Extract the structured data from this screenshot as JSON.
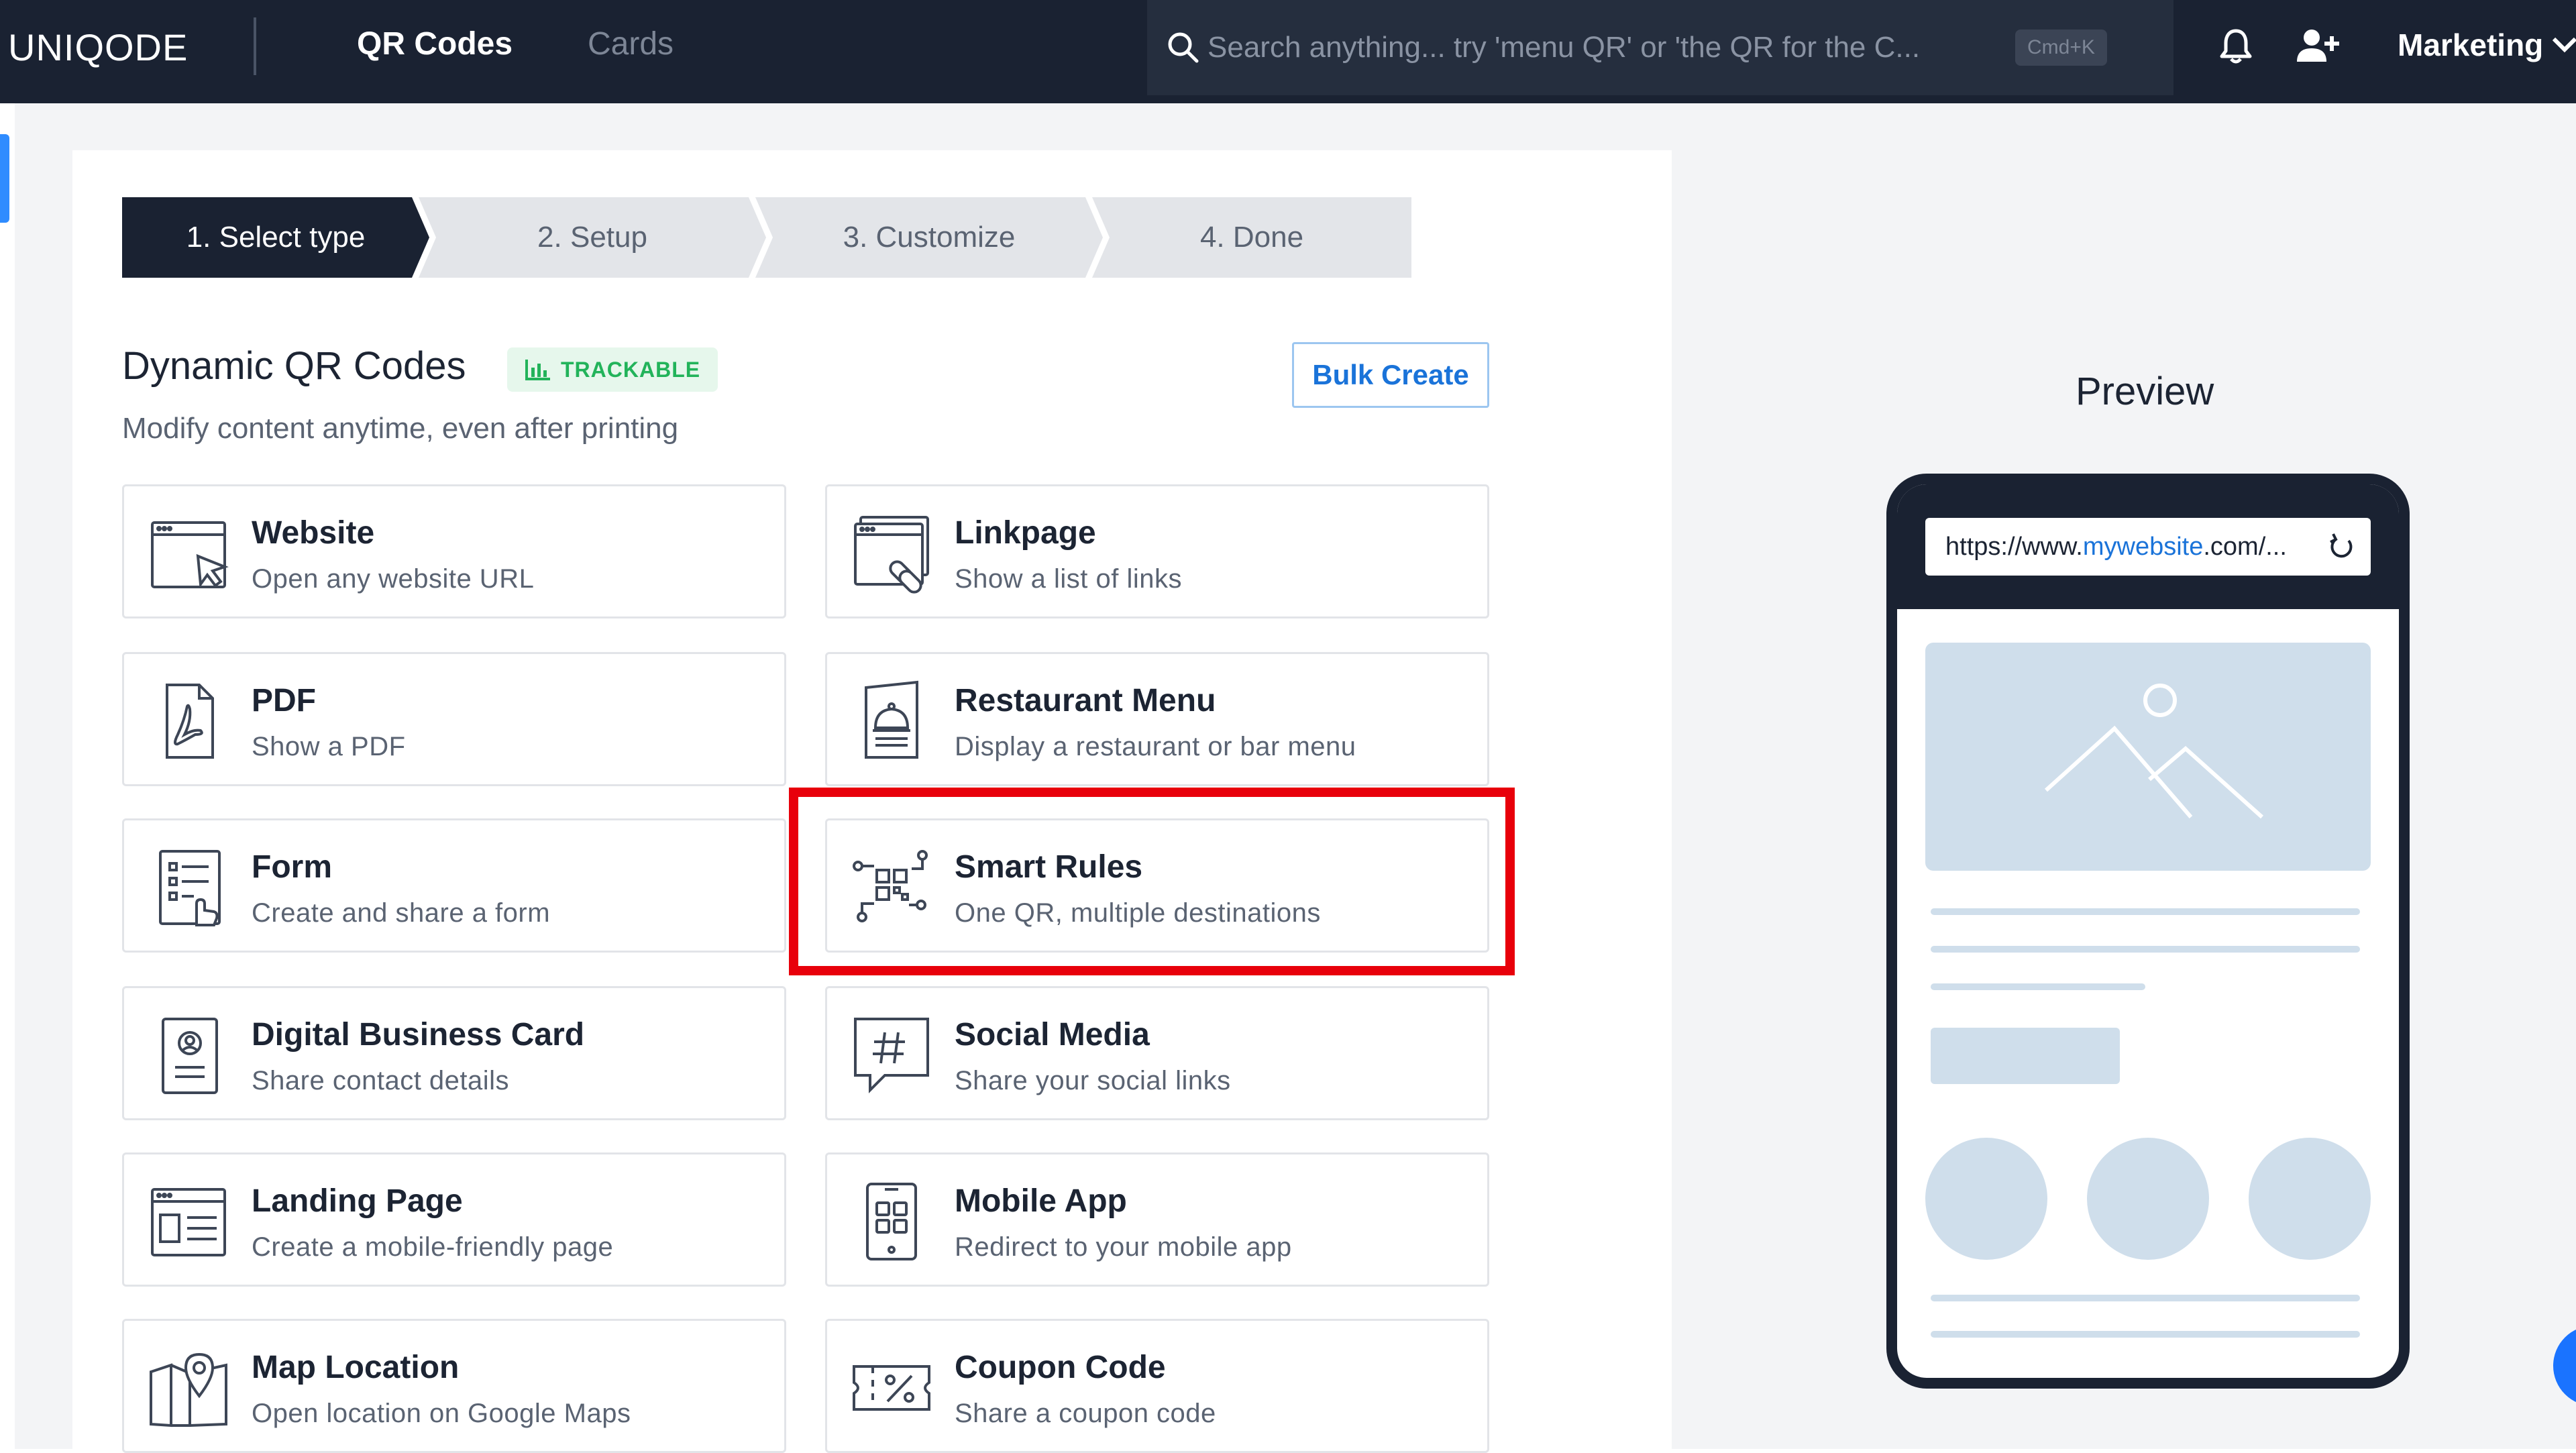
{
  "app": {
    "logo": "UNIQODE",
    "tabs": [
      {
        "label": "QR Codes",
        "active": true
      },
      {
        "label": "Cards",
        "active": false
      }
    ],
    "search": {
      "placeholder": "Search anything... try 'menu QR' or 'the QR for the C...",
      "shortcut": "Cmd+K"
    },
    "workspace": "Marketing"
  },
  "steps": [
    "1. Select type",
    "2. Setup",
    "3. Customize",
    "4. Done"
  ],
  "section": {
    "title": "Dynamic QR Codes",
    "badge": "TRACKABLE",
    "subtitle": "Modify content anytime, even after printing",
    "bulk_button": "Bulk Create"
  },
  "types": [
    {
      "title": "Website",
      "desc": "Open any website URL",
      "icon": "browser-cursor-icon"
    },
    {
      "title": "Linkpage",
      "desc": "Show a list of links",
      "icon": "browser-link-icon"
    },
    {
      "title": "PDF",
      "desc": "Show a PDF",
      "icon": "pdf-icon"
    },
    {
      "title": "Restaurant Menu",
      "desc": "Display a restaurant or bar menu",
      "icon": "cloche-menu-icon"
    },
    {
      "title": "Form",
      "desc": "Create and share a form",
      "icon": "form-icon"
    },
    {
      "title": "Smart Rules",
      "desc": "One QR, multiple destinations",
      "icon": "smart-rules-icon",
      "highlighted": true
    },
    {
      "title": "Digital Business Card",
      "desc": "Share contact details",
      "icon": "business-card-icon"
    },
    {
      "title": "Social Media",
      "desc": "Share your social links",
      "icon": "hashtag-icon"
    },
    {
      "title": "Landing Page",
      "desc": "Create a mobile-friendly page",
      "icon": "landing-page-icon"
    },
    {
      "title": "Mobile App",
      "desc": "Redirect to your mobile app",
      "icon": "mobile-app-icon"
    },
    {
      "title": "Map Location",
      "desc": "Open location on Google Maps",
      "icon": "map-pin-icon"
    },
    {
      "title": "Coupon Code",
      "desc": "Share a coupon code",
      "icon": "coupon-icon"
    }
  ],
  "preview": {
    "title": "Preview",
    "url_prefix": "https://www.",
    "url_domain": "mywebsite",
    "url_suffix": ".com/..."
  },
  "colors": {
    "nav_bg": "#1a2232",
    "accent": "#2f8cff",
    "highlight": "#e8000b",
    "badge_green": "#22b35a",
    "placeholder_blue": "#cfdeeb"
  }
}
